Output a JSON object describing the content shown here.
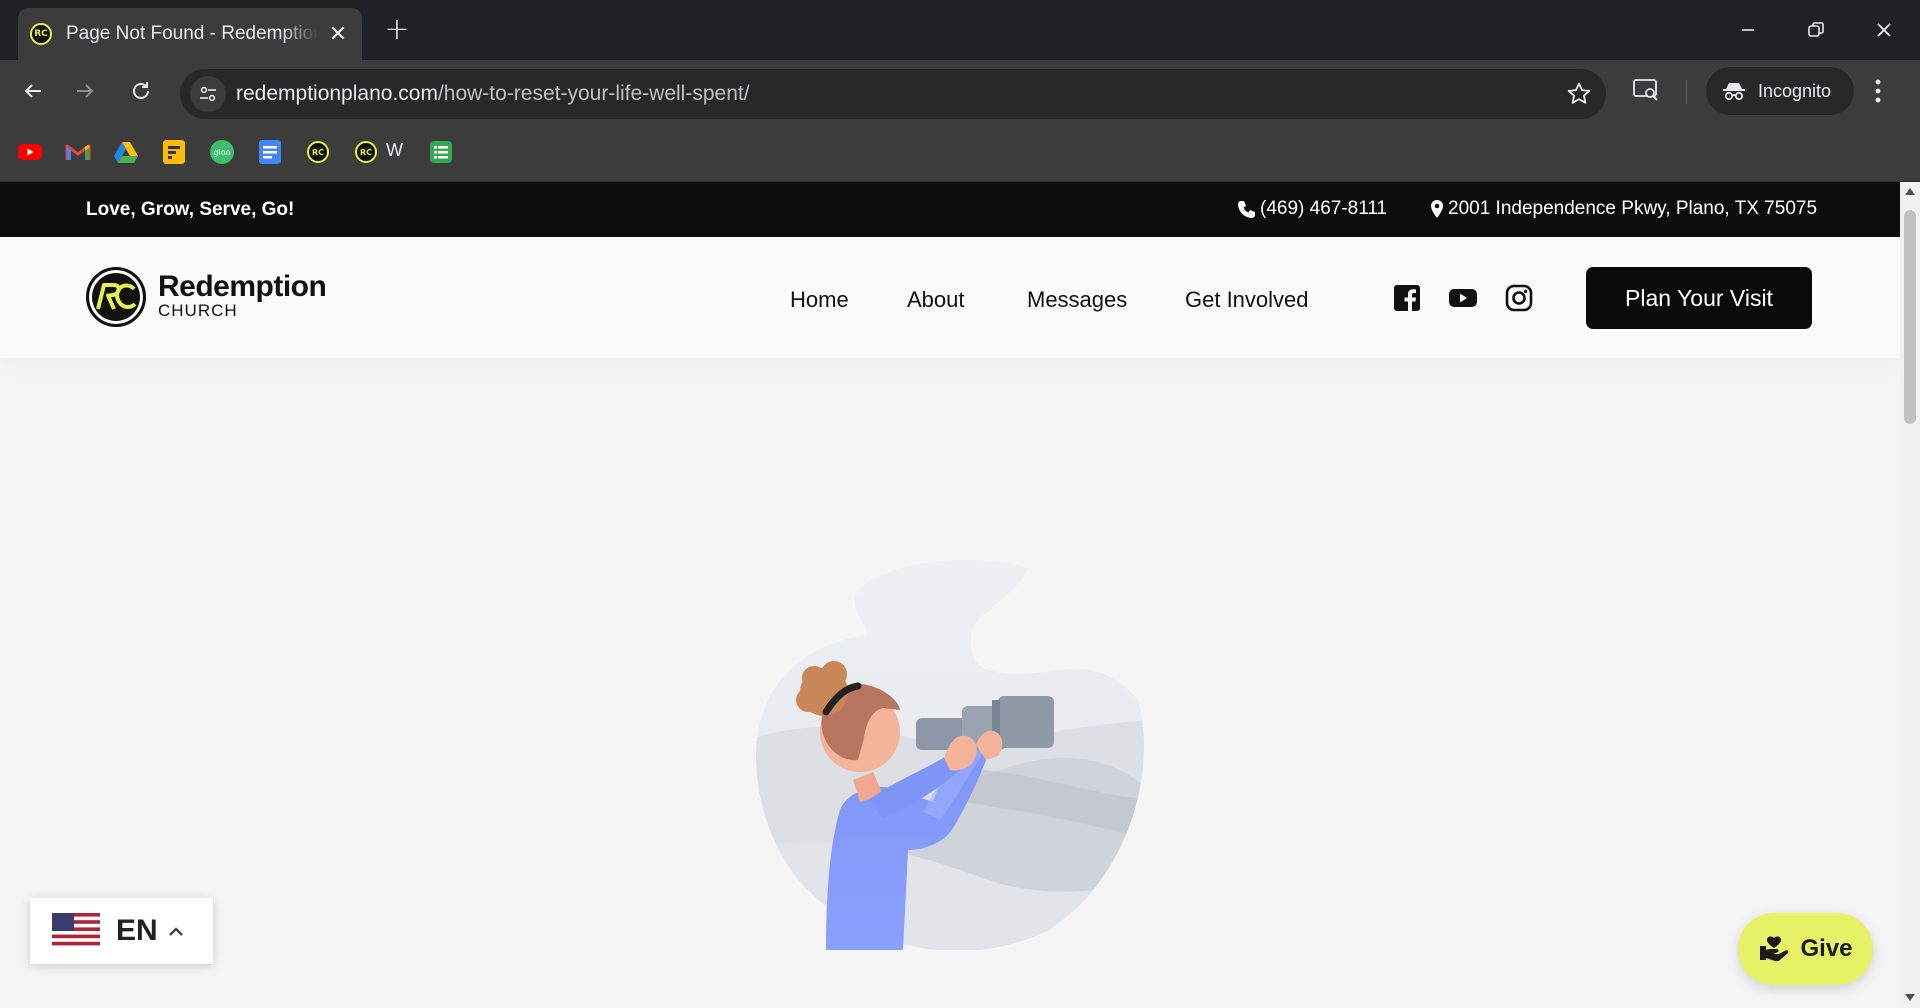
{
  "browser": {
    "tab_title": "Page Not Found - Redemption Church",
    "favicon_text": "RC",
    "url_domain": "redemptionplano.com",
    "url_path": "/how-to-reset-your-life-well-spent/",
    "incognito_label": "Incognito",
    "bookmarks": [
      {
        "icon": "youtube-icon"
      },
      {
        "icon": "gmail-icon"
      },
      {
        "icon": "google-drive-icon"
      },
      {
        "icon": "keep-notes-icon"
      },
      {
        "icon": "gloo-icon",
        "text": "gloo"
      },
      {
        "icon": "google-docs-icon"
      },
      {
        "icon": "redemption-church-icon"
      },
      {
        "icon": "redemption-church-icon",
        "label": "W"
      },
      {
        "icon": "google-sheets-icon"
      }
    ]
  },
  "site": {
    "tagline": "Love, Grow, Serve, Go!",
    "phone": "(469) 467-8111",
    "address": "2001 Independence Pkwy, Plano, TX 75075",
    "logo_name": "Redemption",
    "logo_sub": "CHURCH",
    "nav": [
      "Home",
      "About",
      "Messages",
      "Get Involved"
    ],
    "social": [
      "facebook-icon",
      "youtube-icon",
      "instagram-icon"
    ],
    "cta": "Plan Your Visit",
    "language": "EN",
    "give_label": "Give"
  },
  "colors": {
    "accent": "#e7f165",
    "dark": "#0d0d0d",
    "illustration_blue": "#7f95f5"
  }
}
